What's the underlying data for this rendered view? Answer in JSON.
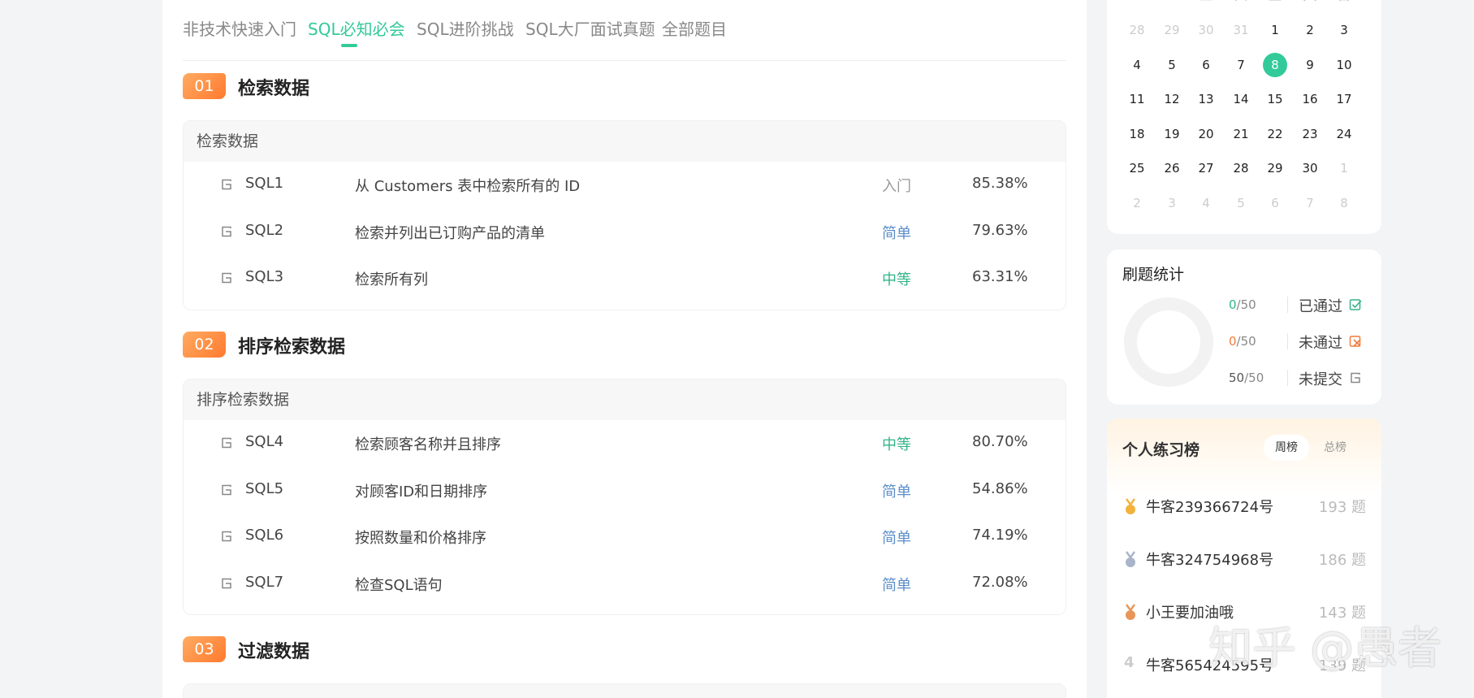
{
  "tabs": [
    {
      "label": "非技术快速入门",
      "active": false
    },
    {
      "label": "SQL必知必会",
      "active": true
    },
    {
      "label": "SQL进阶挑战",
      "active": false
    },
    {
      "label": "SQL大厂面试真题",
      "active": false
    },
    {
      "label": "全部题目",
      "active": false
    }
  ],
  "sections": [
    {
      "number": "01",
      "title": "检索数据",
      "card_title": "检索数据",
      "problems": [
        {
          "code": "SQL1",
          "name": "从 Customers 表中检索所有的 ID",
          "difficulty": "入门",
          "rate": "85.38%"
        },
        {
          "code": "SQL2",
          "name": "检索并列出已订购产品的清单",
          "difficulty": "简单",
          "rate": "79.63%"
        },
        {
          "code": "SQL3",
          "name": "检索所有列",
          "difficulty": "中等",
          "rate": "63.31%"
        }
      ]
    },
    {
      "number": "02",
      "title": "排序检索数据",
      "card_title": "排序检索数据",
      "problems": [
        {
          "code": "SQL4",
          "name": "检索顾客名称并且排序",
          "difficulty": "中等",
          "rate": "80.70%"
        },
        {
          "code": "SQL5",
          "name": "对顾客ID和日期排序",
          "difficulty": "简单",
          "rate": "54.86%"
        },
        {
          "code": "SQL6",
          "name": "按照数量和价格排序",
          "difficulty": "简单",
          "rate": "74.19%"
        },
        {
          "code": "SQL7",
          "name": "检查SQL语句",
          "difficulty": "简单",
          "rate": "72.08%"
        }
      ]
    },
    {
      "number": "03",
      "title": "过滤数据"
    }
  ],
  "calendar": {
    "weekdays": [
      "一",
      "二",
      "三",
      "四",
      "五",
      "六",
      "日"
    ],
    "days": [
      [
        "28",
        "29",
        "30",
        "31",
        "1",
        "2",
        "3"
      ],
      [
        "4",
        "5",
        "6",
        "7",
        "8",
        "9",
        "10"
      ],
      [
        "11",
        "12",
        "13",
        "14",
        "15",
        "16",
        "17"
      ],
      [
        "18",
        "19",
        "20",
        "21",
        "22",
        "23",
        "24"
      ],
      [
        "25",
        "26",
        "27",
        "28",
        "29",
        "30",
        "1"
      ],
      [
        "2",
        "3",
        "4",
        "5",
        "6",
        "7",
        "8"
      ]
    ],
    "today": "8"
  },
  "stats": {
    "title": "刷题统计",
    "rows": [
      {
        "done": "0",
        "total": "/50",
        "label": "已通过",
        "color": "#32b48a",
        "icon": "check-icon"
      },
      {
        "done": "0",
        "total": "/50",
        "label": "未通过",
        "color": "#f07c3c",
        "icon": "cross-icon"
      },
      {
        "done": "50",
        "total": "/50",
        "label": "未提交",
        "color": "#666666",
        "icon": "pending-icon"
      }
    ]
  },
  "ranking": {
    "title": "个人练习榜",
    "tabs": [
      "周榜",
      "总榜"
    ],
    "items": [
      {
        "name": "牛客239366724号",
        "count": "193 题",
        "medal": "gold"
      },
      {
        "name": "牛客324754968号",
        "count": "186 题",
        "medal": "silver"
      },
      {
        "name": "小王要加油哦",
        "count": "143 题",
        "medal": "bronze"
      },
      {
        "name": "牛客565424595号",
        "count": "139 题",
        "rank": "4"
      }
    ]
  },
  "watermark": "知乎 @愚者"
}
